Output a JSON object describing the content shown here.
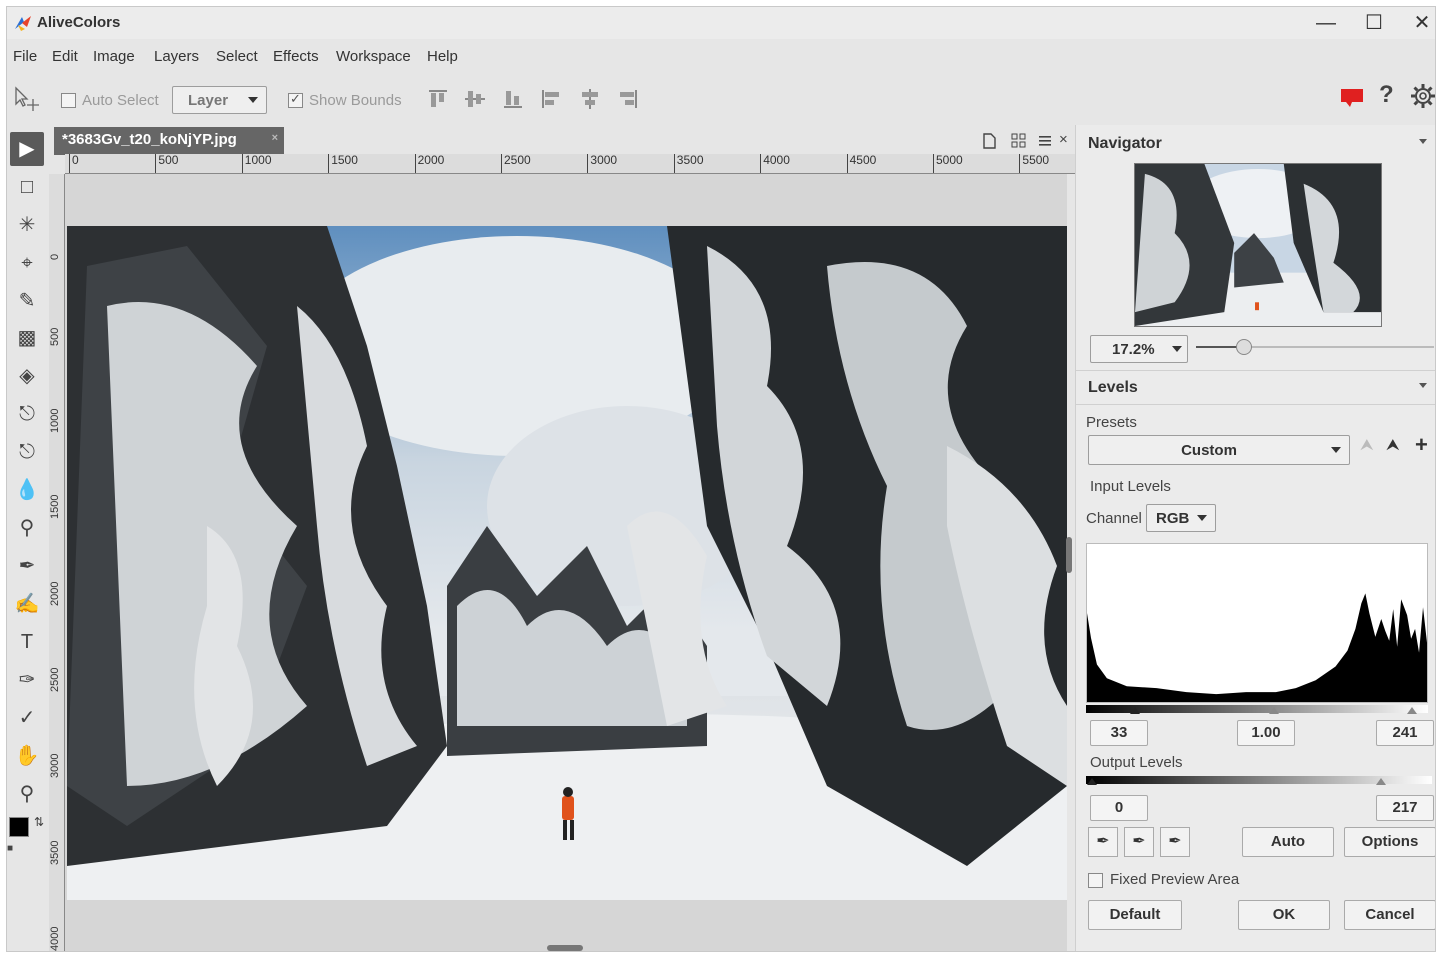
{
  "app": {
    "title": "AliveColors"
  },
  "window_controls": {
    "minimize": "—",
    "maximize": "☐",
    "close": "✕"
  },
  "menu": [
    "File",
    "Edit",
    "Image",
    "Layers",
    "Select",
    "Effects",
    "Workspace",
    "Help"
  ],
  "options_bar": {
    "auto_select_label": "Auto Select",
    "auto_select_checked": false,
    "mode_value": "Layer",
    "show_bounds_label": "Show Bounds",
    "show_bounds_checked": true,
    "help_label": "?",
    "accent_color": "#e02020"
  },
  "document": {
    "tab_label": "*3683Gv_t20_koNjYP.jpg",
    "tab_close": "×",
    "close_label": "×",
    "ruler_h": [
      "0",
      "500",
      "1000",
      "1500",
      "2000",
      "2500",
      "3000",
      "3500",
      "4000",
      "4500",
      "5000",
      "5500"
    ],
    "ruler_v": [
      "0",
      "500",
      "1000",
      "1500",
      "2000",
      "2500",
      "3000",
      "3500",
      "4000"
    ]
  },
  "tools": [
    "move-tool-icon",
    "marquee-icon",
    "magic-wand-icon",
    "crop-icon",
    "brush-icon",
    "eraser-icon",
    "fill-icon",
    "clone-stamp-icon",
    "pattern-stamp-icon",
    "blur-drop-icon",
    "dodge-icon",
    "fx-brush-icon",
    "smudge-icon",
    "text-icon",
    "pen-icon",
    "eyedropper-icon",
    "hand-icon",
    "zoom-icon"
  ],
  "colors": {
    "foreground": "#000000",
    "background": "#ffffff"
  },
  "navigator": {
    "title": "Navigator",
    "zoom_value": "17.2%",
    "zoom_slider_fraction": 0.2
  },
  "levels": {
    "title": "Levels",
    "presets_label": "Presets",
    "preset_value": "Custom",
    "input_levels_label": "Input Levels",
    "channel_label": "Channel",
    "channel_value": "RGB",
    "input_black": "33",
    "input_gamma": "1.00",
    "input_white": "241",
    "output_levels_label": "Output Levels",
    "output_black": "0",
    "output_white": "217",
    "auto_label": "Auto",
    "options_label": "Options",
    "fixed_preview_label": "Fixed Preview Area",
    "fixed_preview_checked": false,
    "default_label": "Default",
    "ok_label": "OK",
    "cancel_label": "Cancel"
  }
}
